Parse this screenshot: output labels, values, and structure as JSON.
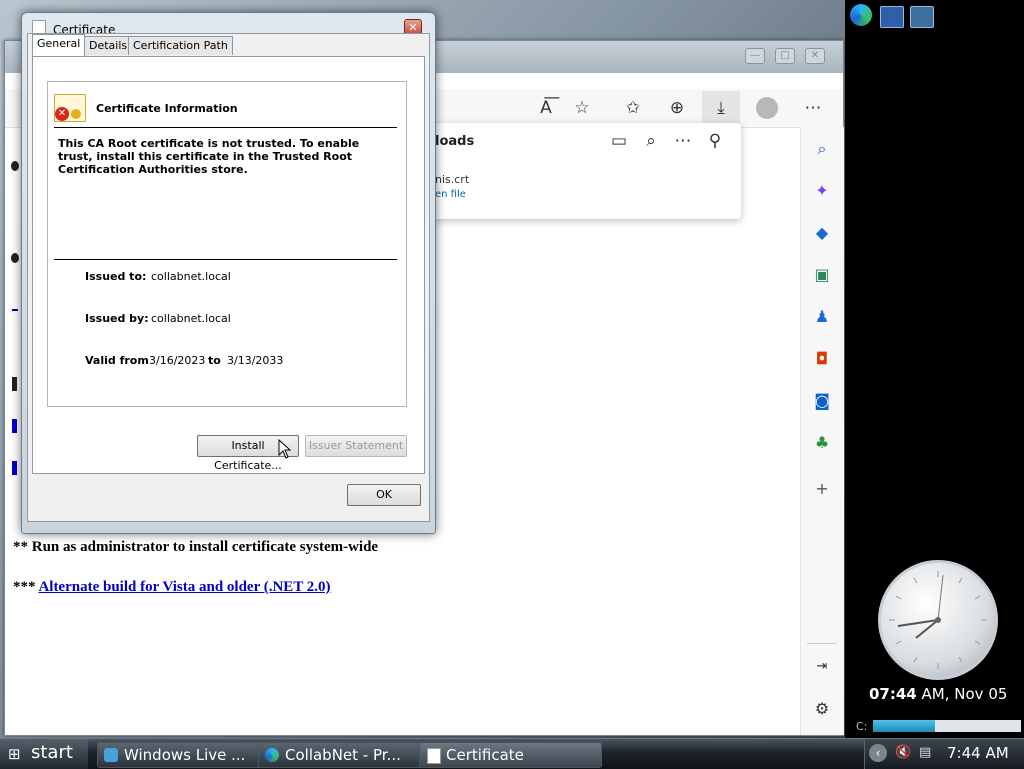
{
  "browser": {
    "page_lines": {
      "admin_note": "** Run as administrator to install certificate system-wide",
      "alt_prefix": "***",
      "alt_link": "Alternate build for Vista and older (.NET 2.0)"
    },
    "toolbar_icons": [
      "read-aloud-icon",
      "add-favorite-icon",
      "favorites-icon",
      "collections-icon",
      "downloads-icon",
      "profile-icon",
      "more-icon"
    ]
  },
  "downloads": {
    "title": "loads",
    "file_name": "nis.crt",
    "open_link": "en file"
  },
  "cert_dialog": {
    "title": "Certificate",
    "tabs": [
      "General",
      "Details",
      "Certification Path"
    ],
    "heading": "Certificate Information",
    "warning": "This CA Root certificate is not trusted. To enable trust, install this certificate in the Trusted Root Certification Authorities store.",
    "issued_to_label": "Issued to:",
    "issued_to": "collabnet.local",
    "issued_by_label": "Issued by:",
    "issued_by": "collabnet.local",
    "valid_from_label": "Valid from",
    "valid_from": "3/16/2023",
    "to_label": "to",
    "valid_to": "3/13/2033",
    "install_button": "Install Certificate...",
    "issuer_button": "Issuer Statement",
    "ok_button": "OK"
  },
  "gadget": {
    "time": "07:44",
    "suffix": "AM, Nov 05",
    "drive": "C:"
  },
  "taskbar": {
    "start": "start",
    "tasks": [
      "Windows Live ...",
      "CollabNet - Pr...",
      "Certificate"
    ],
    "clock": "7:44 AM"
  },
  "colors": {
    "link": "#0000cc",
    "taskbar": "#1d2329"
  }
}
